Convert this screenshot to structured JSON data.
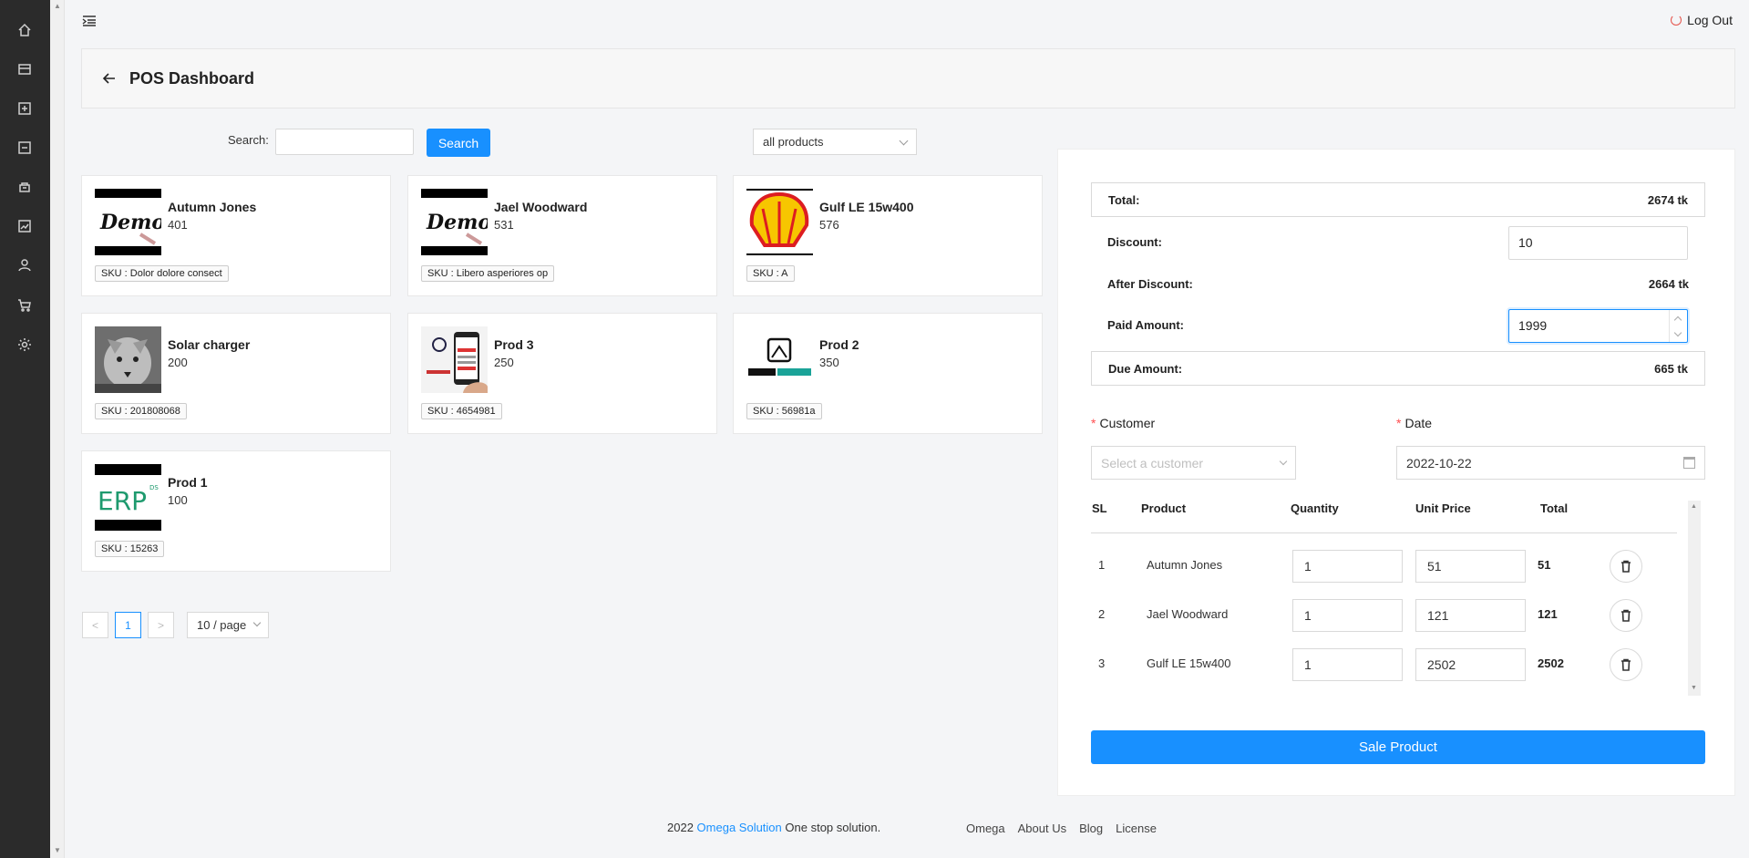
{
  "sidebar": {
    "items": [
      "home-icon",
      "shop-icon",
      "add-icon",
      "minus-icon",
      "box-icon",
      "chart-icon",
      "user-icon",
      "cart-icon",
      "settings-icon"
    ]
  },
  "topbar": {
    "logout_label": "Log Out"
  },
  "header": {
    "title": "POS Dashboard"
  },
  "search": {
    "label": "Search",
    "placeholder": "",
    "button_label": "Search"
  },
  "filter": {
    "selected": "all products"
  },
  "products": [
    {
      "name": "Autumn Jones",
      "price": "401",
      "sku": "SKU : Dolor dolore consect",
      "thumb": "demo"
    },
    {
      "name": "Jael Woodward",
      "price": "531",
      "sku": "SKU : Libero asperiores op",
      "thumb": "demo"
    },
    {
      "name": "Gulf LE 15w400",
      "price": "576",
      "sku": "SKU : A",
      "thumb": "shell"
    },
    {
      "name": "Solar charger",
      "price": "200",
      "sku": "SKU : 201808068",
      "thumb": "wolf"
    },
    {
      "name": "Prod 3",
      "price": "250",
      "sku": "SKU : 4654981",
      "thumb": "phone"
    },
    {
      "name": "Prod 2",
      "price": "350",
      "sku": "SKU : 56981a",
      "thumb": "omega"
    },
    {
      "name": "Prod 1",
      "price": "100",
      "sku": "SKU : 15263",
      "thumb": "erp"
    }
  ],
  "pagination": {
    "prev": "<",
    "current": "1",
    "next": ">",
    "page_size": "10 / page"
  },
  "summary": {
    "total_label": "Total:",
    "total_value": "2674 tk",
    "discount_label": "Discount:",
    "discount_value": "10",
    "after_discount_label": "After Discount:",
    "after_discount_value": "2664 tk",
    "paid_label": "Paid Amount:",
    "paid_value": "1999",
    "due_label": "Due Amount:",
    "due_value": "665 tk"
  },
  "form": {
    "customer_label": "Customer",
    "customer_placeholder": "Select a customer",
    "date_label": "Date",
    "date_value": "2022-10-22",
    "required_mark": "*"
  },
  "cart": {
    "headers": {
      "sl": "SL",
      "product": "Product",
      "quantity": "Quantity",
      "unit_price": "Unit Price",
      "total": "Total"
    },
    "rows": [
      {
        "sl": "1",
        "product": "Autumn Jones",
        "quantity": "1",
        "unit_price": "51",
        "total": "51"
      },
      {
        "sl": "2",
        "product": "Jael Woodward",
        "quantity": "1",
        "unit_price": "121",
        "total": "121"
      },
      {
        "sl": "3",
        "product": "Gulf LE 15w400",
        "quantity": "1",
        "unit_price": "2502",
        "total": "2502"
      }
    ]
  },
  "sale_button": "Sale Product",
  "footer": {
    "year": "2022",
    "brand": "Omega Solution",
    "tagline": "One stop solution.",
    "links": [
      "Omega",
      "About Us",
      "Blog",
      "License"
    ]
  },
  "colors": {
    "primary": "#1890ff",
    "sidebar": "#2b2b2b",
    "required": "#ff4d4f"
  }
}
